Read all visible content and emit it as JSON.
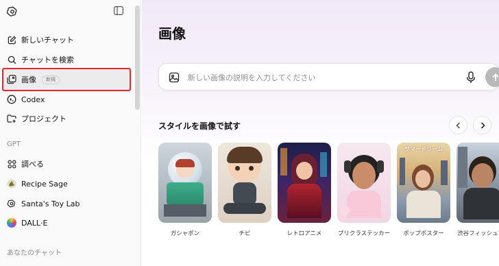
{
  "sidebar": {
    "items": [
      {
        "label": "新しいチャット",
        "icon": "new-chat-icon"
      },
      {
        "label": "チャットを検索",
        "icon": "search-icon"
      },
      {
        "label": "画像",
        "icon": "images-icon",
        "badge": "新規",
        "selected": true
      },
      {
        "label": "Codex",
        "icon": "codex-icon"
      },
      {
        "label": "プロジェクト",
        "icon": "folder-plus-icon"
      }
    ],
    "gpt_section_label": "GPT",
    "gpts": [
      {
        "label": "調べる",
        "icon": "grid-icon"
      },
      {
        "label": "Recipe Sage",
        "icon": "recipe-sage-avatar"
      },
      {
        "label": "Santa's Toy Lab",
        "icon": "openai-logo-icon"
      },
      {
        "label": "DALL·E",
        "icon": "dalle-avatar"
      }
    ],
    "chats_section_label": "あなたのチャット"
  },
  "main": {
    "title": "画像",
    "prompt": {
      "placeholder": "新しい画像の説明を入力してください",
      "value": ""
    },
    "styles_heading": "スタイルを画像で試す",
    "styles": [
      {
        "label": "ガシャポン",
        "thumb_text": ""
      },
      {
        "label": "チビ",
        "thumb_text": ""
      },
      {
        "label": "レトロアニメ",
        "thumb_text": ""
      },
      {
        "label": "プリクラステッカー",
        "thumb_text": ""
      },
      {
        "label": "ポップポスター",
        "thumb_text": "サマードリーム"
      },
      {
        "label": "渋谷フィッシュアイ",
        "thumb_text": ""
      }
    ]
  },
  "colors": {
    "selection_outline": "#e8242f",
    "send_button": "#b9b9b9",
    "sidebar_bg": "#f9f9f9"
  }
}
